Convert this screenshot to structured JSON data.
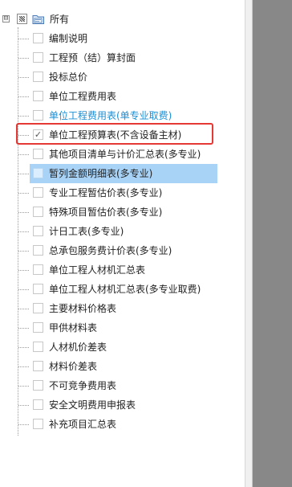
{
  "tree": {
    "root": {
      "label": "所有",
      "expander": "⊟",
      "state": "partial"
    },
    "items": [
      {
        "label": "编制说明",
        "checked": false,
        "style": "normal"
      },
      {
        "label": "工程预（结）算封面",
        "checked": false,
        "style": "normal"
      },
      {
        "label": "投标总价",
        "checked": false,
        "style": "normal"
      },
      {
        "label": "单位工程费用表",
        "checked": false,
        "style": "normal"
      },
      {
        "label": "单位工程费用表(单专业取费)",
        "checked": false,
        "style": "blue"
      },
      {
        "label": "单位工程预算表(不含设备主材)",
        "checked": true,
        "style": "normal",
        "check_glyph": "✓"
      },
      {
        "label": "其他项目清单与计价汇总表(多专业)",
        "checked": false,
        "style": "normal"
      },
      {
        "label": "暂列金额明细表(多专业)",
        "checked": false,
        "style": "highlight"
      },
      {
        "label": "专业工程暂估价表(多专业)",
        "checked": false,
        "style": "normal"
      },
      {
        "label": "特殊项目暂估价表(多专业)",
        "checked": false,
        "style": "normal"
      },
      {
        "label": "计日工表(多专业)",
        "checked": false,
        "style": "normal"
      },
      {
        "label": "总承包服务费计价表(多专业)",
        "checked": false,
        "style": "normal"
      },
      {
        "label": "单位工程人材机汇总表",
        "checked": false,
        "style": "normal"
      },
      {
        "label": "单位工程人材机汇总表(多专业取费)",
        "checked": false,
        "style": "normal"
      },
      {
        "label": "主要材料价格表",
        "checked": false,
        "style": "normal"
      },
      {
        "label": "甲供材料表",
        "checked": false,
        "style": "normal"
      },
      {
        "label": "人材机价差表",
        "checked": false,
        "style": "normal"
      },
      {
        "label": "材料价差表",
        "checked": false,
        "style": "normal"
      },
      {
        "label": "不可竞争费用表",
        "checked": false,
        "style": "normal"
      },
      {
        "label": "安全文明费用申报表",
        "checked": false,
        "style": "normal"
      },
      {
        "label": "补充项目汇总表",
        "checked": false,
        "style": "normal"
      }
    ]
  },
  "colors": {
    "selection": "#a8d3f7",
    "link_blue": "#1a8fd6",
    "annotation_red": "#e53935",
    "side_gray": "#888888"
  }
}
